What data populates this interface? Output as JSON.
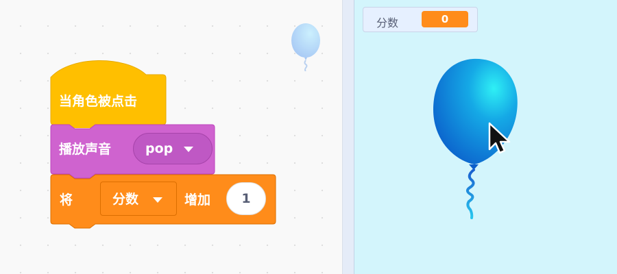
{
  "code_area": {
    "sprite_thumbnail_icon": "balloon-icon",
    "hat_block": {
      "label": "当角色被点击"
    },
    "sound_block": {
      "label": "播放声音",
      "sound_value": "pop"
    },
    "variable_block": {
      "label_set": "将",
      "variable_value": "分数",
      "label_change": "增加",
      "amount": "1"
    }
  },
  "stage": {
    "monitor": {
      "label": "分数",
      "value": "0"
    },
    "sprite_icon": "balloon-icon"
  },
  "colors": {
    "events_block": "#ffbf00",
    "sound_block": "#cf63cf",
    "variables_block": "#ff8c1a",
    "stage_background": "#d3f5fc",
    "balloon": "#1e8fdc"
  }
}
